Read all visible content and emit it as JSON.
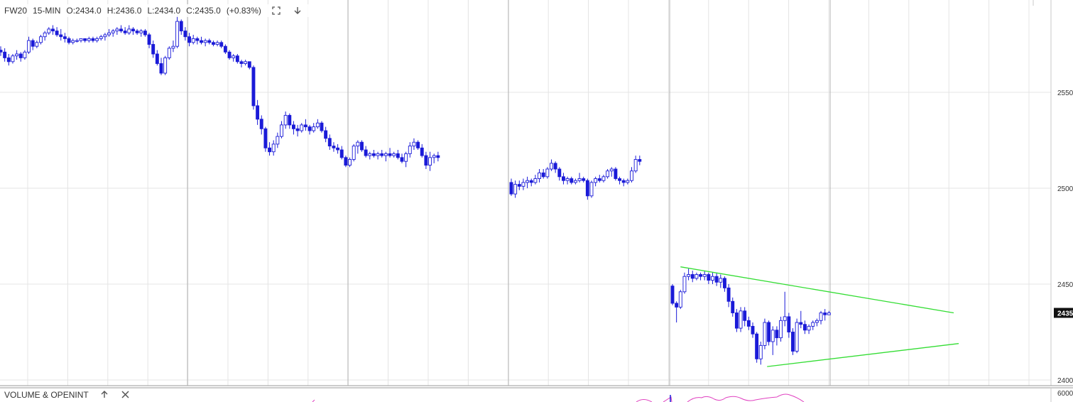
{
  "header": {
    "symbol": "FW20",
    "interval": "15-MIN",
    "open": "O:2434.0",
    "high": "H:2436.0",
    "low": "L:2434.0",
    "close": "C:2435.0",
    "change": "(+0.83%)",
    "fullscreen_icon": "expand-icon",
    "menu_icon": "arrow-down-icon"
  },
  "lower_panel": {
    "title": "VOLUME & OPENINT",
    "up_icon": "arrow-up-icon",
    "close_icon": "close-icon",
    "scale_label": "6000"
  },
  "colors": {
    "bear_candle": "#1a1ad8",
    "bull_candle": "#ffffff",
    "candle_outline": "#1a1ad8",
    "trendline": "#33dd33",
    "volume_line": "#e040c0",
    "grid": "#e4e4e4",
    "session_line": "#b0b0b0",
    "last_price_tag": "#111111"
  },
  "chart_data": {
    "type": "candlestick",
    "title": "",
    "yaxis": {
      "ticks": [
        2400,
        2450,
        2500,
        2550
      ],
      "tick_labels": [
        "2400",
        "2450",
        "2500",
        "2550"
      ],
      "range": [
        2398,
        2595
      ],
      "last_price": 2435,
      "last_price_label": "2435"
    },
    "segments": [
      {
        "name": "session-1",
        "ohlc": [
          [
            2572,
            2574,
            2569,
            2571
          ],
          [
            2571,
            2573,
            2566,
            2568
          ],
          [
            2568,
            2570,
            2564,
            2566
          ],
          [
            2566,
            2570,
            2565,
            2569
          ],
          [
            2569,
            2572,
            2567,
            2570
          ],
          [
            2570,
            2571,
            2566,
            2568
          ],
          [
            2568,
            2572,
            2567,
            2571
          ],
          [
            2571,
            2579,
            2570,
            2577
          ],
          [
            2577,
            2578,
            2572,
            2574
          ],
          [
            2574,
            2577,
            2573,
            2576
          ],
          [
            2576,
            2580,
            2575,
            2579
          ],
          [
            2579,
            2582,
            2577,
            2581
          ],
          [
            2581,
            2584,
            2580,
            2583
          ],
          [
            2583,
            2585,
            2580,
            2582
          ],
          [
            2582,
            2584,
            2579,
            2580
          ],
          [
            2580,
            2583,
            2577,
            2579
          ],
          [
            2579,
            2581,
            2576,
            2578
          ],
          [
            2578,
            2579,
            2575,
            2576
          ],
          [
            2576,
            2578,
            2575,
            2577
          ],
          [
            2577,
            2578,
            2576,
            2577
          ],
          [
            2577,
            2578,
            2576,
            2578
          ],
          [
            2578,
            2578,
            2576,
            2577
          ],
          [
            2577,
            2579,
            2576,
            2578
          ],
          [
            2578,
            2579,
            2576,
            2577
          ],
          [
            2577,
            2579,
            2576,
            2578
          ],
          [
            2578,
            2580,
            2577,
            2579
          ],
          [
            2579,
            2581,
            2577,
            2580
          ],
          [
            2580,
            2583,
            2579,
            2581
          ],
          [
            2581,
            2583,
            2579,
            2582
          ],
          [
            2582,
            2584,
            2580,
            2583
          ],
          [
            2583,
            2585,
            2581,
            2582
          ],
          [
            2582,
            2584,
            2580,
            2581
          ],
          [
            2581,
            2585,
            2580,
            2583
          ],
          [
            2583,
            2584,
            2580,
            2582
          ],
          [
            2582,
            2583,
            2580,
            2581
          ],
          [
            2581,
            2583,
            2579,
            2582
          ],
          [
            2582,
            2583,
            2579,
            2580
          ],
          [
            2580,
            2581,
            2573,
            2575
          ],
          [
            2575,
            2577,
            2568,
            2570
          ],
          [
            2570,
            2572,
            2564,
            2565
          ],
          [
            2565,
            2568,
            2559,
            2560
          ],
          [
            2560,
            2569,
            2559,
            2568
          ],
          [
            2568,
            2574,
            2567,
            2573
          ],
          [
            2573,
            2577,
            2571,
            2574
          ],
          [
            2574,
            2590,
            2573,
            2587
          ],
          [
            2587,
            2588,
            2580,
            2582
          ],
          [
            2582,
            2584,
            2577,
            2579
          ],
          [
            2579,
            2581,
            2574,
            2576
          ],
          [
            2576,
            2580,
            2575,
            2578
          ],
          [
            2578,
            2579,
            2575,
            2577
          ],
          [
            2577,
            2579,
            2575,
            2576
          ],
          [
            2576,
            2578,
            2574,
            2577
          ],
          [
            2577,
            2578,
            2575,
            2576
          ],
          [
            2576,
            2577,
            2574,
            2575
          ],
          [
            2575,
            2577,
            2574,
            2576
          ],
          [
            2576,
            2577,
            2573,
            2574
          ],
          [
            2574,
            2575,
            2570,
            2571
          ],
          [
            2571,
            2572,
            2567,
            2568
          ],
          [
            2568,
            2570,
            2566,
            2569
          ],
          [
            2569,
            2570,
            2565,
            2566
          ],
          [
            2566,
            2567,
            2563,
            2565
          ],
          [
            2565,
            2567,
            2564,
            2566
          ],
          [
            2566,
            2566,
            2562,
            2563
          ],
          [
            2563,
            2564,
            2541,
            2543
          ],
          [
            2543,
            2546,
            2533,
            2536
          ],
          [
            2536,
            2538,
            2528,
            2531
          ],
          [
            2531,
            2532,
            2519,
            2521
          ],
          [
            2521,
            2524,
            2517,
            2519
          ],
          [
            2519,
            2525,
            2517,
            2523
          ],
          [
            2523,
            2529,
            2521,
            2527
          ],
          [
            2527,
            2535,
            2526,
            2533
          ],
          [
            2533,
            2540,
            2531,
            2538
          ],
          [
            2538,
            2539,
            2531,
            2533
          ],
          [
            2533,
            2535,
            2528,
            2531
          ],
          [
            2531,
            2533,
            2527,
            2530
          ],
          [
            2530,
            2534,
            2529,
            2533
          ],
          [
            2533,
            2536,
            2530,
            2532
          ],
          [
            2532,
            2533,
            2528,
            2530
          ],
          [
            2530,
            2534,
            2529,
            2532
          ],
          [
            2532,
            2536,
            2531,
            2534
          ],
          [
            2534,
            2535,
            2529,
            2530
          ],
          [
            2530,
            2532,
            2524,
            2526
          ],
          [
            2526,
            2528,
            2520,
            2522
          ],
          [
            2522,
            2524,
            2519,
            2521
          ],
          [
            2521,
            2523,
            2518,
            2520
          ],
          [
            2520,
            2522,
            2515,
            2516
          ],
          [
            2516,
            2517,
            2511,
            2512
          ],
          [
            2512,
            2516,
            2511,
            2515
          ],
          [
            2515,
            2523,
            2514,
            2522
          ],
          [
            2522,
            2525,
            2518,
            2524
          ],
          [
            2524,
            2525,
            2519,
            2520
          ],
          [
            2520,
            2522,
            2516,
            2517
          ],
          [
            2517,
            2519,
            2515,
            2518
          ],
          [
            2518,
            2520,
            2516,
            2517
          ],
          [
            2517,
            2519,
            2515,
            2518
          ],
          [
            2518,
            2520,
            2516,
            2517
          ],
          [
            2517,
            2519,
            2514,
            2518
          ],
          [
            2518,
            2521,
            2516,
            2517
          ],
          [
            2517,
            2519,
            2516,
            2518
          ],
          [
            2518,
            2520,
            2515,
            2516
          ],
          [
            2516,
            2518,
            2513,
            2514
          ],
          [
            2514,
            2519,
            2511,
            2518
          ],
          [
            2518,
            2524,
            2516,
            2522
          ],
          [
            2522,
            2526,
            2520,
            2524
          ],
          [
            2524,
            2525,
            2520,
            2521
          ],
          [
            2521,
            2523,
            2516,
            2517
          ],
          [
            2517,
            2519,
            2510,
            2512
          ],
          [
            2512,
            2519,
            2509,
            2516
          ],
          [
            2516,
            2518,
            2513,
            2517
          ],
          [
            2517,
            2519,
            2514,
            2516
          ]
        ]
      },
      {
        "name": "session-2",
        "ohlc": [
          [
            2503,
            2505,
            2496,
            2497
          ],
          [
            2497,
            2504,
            2495,
            2502
          ],
          [
            2502,
            2504,
            2499,
            2501
          ],
          [
            2501,
            2505,
            2499,
            2503
          ],
          [
            2503,
            2506,
            2500,
            2504
          ],
          [
            2504,
            2505,
            2501,
            2503
          ],
          [
            2503,
            2507,
            2502,
            2505
          ],
          [
            2505,
            2510,
            2503,
            2508
          ],
          [
            2508,
            2510,
            2505,
            2506
          ],
          [
            2506,
            2511,
            2505,
            2510
          ],
          [
            2510,
            2515,
            2509,
            2513
          ],
          [
            2513,
            2514,
            2508,
            2510
          ],
          [
            2510,
            2511,
            2504,
            2506
          ],
          [
            2506,
            2508,
            2502,
            2504
          ],
          [
            2504,
            2506,
            2502,
            2505
          ],
          [
            2505,
            2506,
            2502,
            2503
          ],
          [
            2503,
            2505,
            2502,
            2504
          ],
          [
            2504,
            2508,
            2503,
            2505
          ],
          [
            2505,
            2506,
            2503,
            2504
          ],
          [
            2504,
            2505,
            2494,
            2496
          ],
          [
            2496,
            2504,
            2495,
            2503
          ],
          [
            2503,
            2506,
            2501,
            2505
          ],
          [
            2505,
            2507,
            2503,
            2504
          ],
          [
            2504,
            2507,
            2503,
            2506
          ],
          [
            2506,
            2510,
            2505,
            2509
          ],
          [
            2509,
            2511,
            2506,
            2510
          ],
          [
            2510,
            2511,
            2504,
            2505
          ],
          [
            2505,
            2506,
            2502,
            2504
          ],
          [
            2504,
            2505,
            2501,
            2503
          ],
          [
            2503,
            2505,
            2502,
            2504
          ],
          [
            2504,
            2511,
            2503,
            2509
          ],
          [
            2509,
            2517,
            2508,
            2515
          ],
          [
            2515,
            2517,
            2512,
            2514
          ]
        ]
      },
      {
        "name": "session-3",
        "ohlc": [
          [
            2449,
            2450,
            2439,
            2440
          ],
          [
            2440,
            2441,
            2430,
            2438
          ],
          [
            2438,
            2447,
            2437,
            2446
          ],
          [
            2446,
            2456,
            2445,
            2454
          ],
          [
            2454,
            2458,
            2452,
            2455
          ],
          [
            2455,
            2457,
            2451,
            2453
          ],
          [
            2453,
            2456,
            2452,
            2455
          ],
          [
            2455,
            2456,
            2452,
            2454
          ],
          [
            2454,
            2457,
            2452,
            2455
          ],
          [
            2455,
            2456,
            2450,
            2452
          ],
          [
            2452,
            2456,
            2450,
            2454
          ],
          [
            2454,
            2456,
            2449,
            2451
          ],
          [
            2451,
            2455,
            2448,
            2453
          ],
          [
            2453,
            2454,
            2446,
            2448
          ],
          [
            2448,
            2450,
            2438,
            2441
          ],
          [
            2441,
            2443,
            2433,
            2435
          ],
          [
            2435,
            2437,
            2425,
            2427
          ],
          [
            2427,
            2438,
            2425,
            2436
          ],
          [
            2436,
            2438,
            2428,
            2431
          ],
          [
            2431,
            2433,
            2426,
            2428
          ],
          [
            2428,
            2430,
            2422,
            2424
          ],
          [
            2424,
            2425,
            2409,
            2411
          ],
          [
            2411,
            2420,
            2408,
            2418
          ],
          [
            2418,
            2432,
            2416,
            2430
          ],
          [
            2430,
            2431,
            2418,
            2420
          ],
          [
            2420,
            2428,
            2413,
            2426
          ],
          [
            2426,
            2428,
            2418,
            2422
          ],
          [
            2422,
            2433,
            2420,
            2431
          ],
          [
            2431,
            2446,
            2428,
            2433
          ],
          [
            2433,
            2435,
            2422,
            2425
          ],
          [
            2425,
            2427,
            2413,
            2415
          ],
          [
            2415,
            2432,
            2414,
            2430
          ],
          [
            2430,
            2436,
            2427,
            2429
          ],
          [
            2429,
            2431,
            2424,
            2426
          ],
          [
            2426,
            2429,
            2424,
            2428
          ],
          [
            2428,
            2431,
            2426,
            2430
          ],
          [
            2430,
            2432,
            2428,
            2431
          ],
          [
            2431,
            2436,
            2429,
            2435
          ],
          [
            2435,
            2437,
            2431,
            2434
          ],
          [
            2434,
            2436,
            2434,
            2435
          ]
        ]
      }
    ],
    "trendlines": [
      {
        "name": "upper-trendline",
        "from": [
          "session-3 bar 2",
          2459
        ],
        "to": [
          "future",
          2435
        ]
      },
      {
        "name": "lower-trendline",
        "from": [
          "session-3 bar 25",
          2407
        ],
        "to": [
          "future",
          2419
        ]
      }
    ],
    "grid": true,
    "legend": "none"
  }
}
